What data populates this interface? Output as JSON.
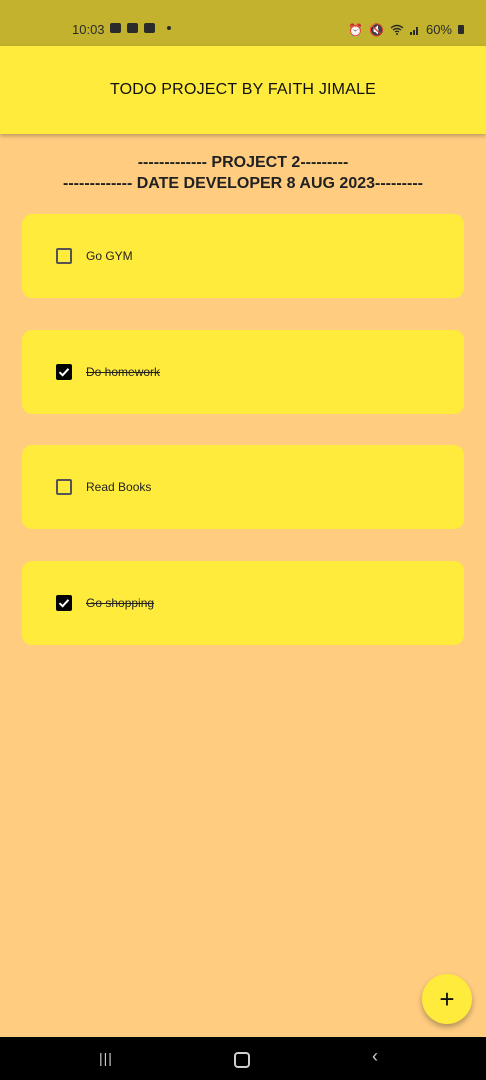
{
  "status_bar": {
    "time": "10:03",
    "battery": "60%",
    "left_icons": [
      "alarm-icon",
      "youtube-icon",
      "app-icon"
    ],
    "right_icons": [
      "alarm-icon",
      "mute-icon",
      "wifi-icon",
      "signal-icon",
      "battery-icon"
    ]
  },
  "app_bar": {
    "title": "TODO PROJECT BY FAITH JIMALE"
  },
  "headings": {
    "line1": "------------- PROJECT 2---------",
    "line2": "------------- DATE DEVELOPER 8 AUG 2023---------"
  },
  "todos": [
    {
      "label": "Go GYM",
      "done": false
    },
    {
      "label": "Do homework",
      "done": true
    },
    {
      "label": "Read Books",
      "done": false
    },
    {
      "label": "Go shopping",
      "done": true
    }
  ],
  "fab": {
    "label": "+"
  },
  "nav": {
    "recent": "|||",
    "back": "‹"
  },
  "colors": {
    "background": "#FFCC80",
    "app_bar": "#FFEB3B",
    "status_bar": "#C2B22D",
    "card": "#FFEB3B"
  }
}
